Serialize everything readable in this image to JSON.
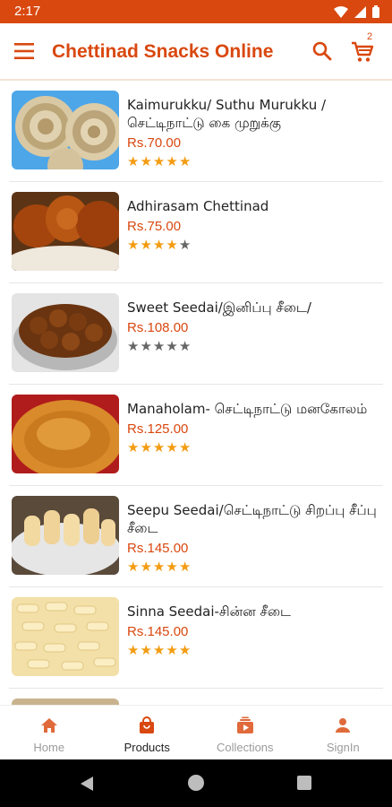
{
  "status": {
    "time": "2:17"
  },
  "appbar": {
    "title": "Chettinad Snacks Online",
    "cart_count": "2"
  },
  "products": [
    {
      "name": "Kaimurukku/ Suthu Murukku / செட்டிநாட்டு கை  முறுக்கு",
      "price": "Rs.70.00",
      "rating": 5,
      "image": "murukku-image"
    },
    {
      "name": "Adhirasam Chettinad",
      "price": "Rs.75.00",
      "rating": 4,
      "image": "adhirasam-image"
    },
    {
      "name": "Sweet Seedai/இனிப்பு சீடை/",
      "price": "Rs.108.00",
      "rating": 0,
      "image": "sweet-seedai-image"
    },
    {
      "name": "Manaholam- செட்டிநாட்டு மனகோலம்",
      "price": "Rs.125.00",
      "rating": 5,
      "image": "manaholam-image"
    },
    {
      "name": "Seepu Seedai/செட்டிநாட்டு சிறப்பு சீப்பு சீடை",
      "price": "Rs.145.00",
      "rating": 5,
      "image": "seepu-seedai-image"
    },
    {
      "name": "Sinna Seedai-சின்ன சீடை",
      "price": "Rs.145.00",
      "rating": 5,
      "image": "sinna-seedai-image"
    }
  ],
  "tabs": [
    {
      "label": "Home",
      "icon": "home-icon"
    },
    {
      "label": "Products",
      "icon": "bag-icon"
    },
    {
      "label": "Collections",
      "icon": "collections-icon"
    },
    {
      "label": "SignIn",
      "icon": "person-icon"
    }
  ],
  "colors": {
    "accent": "#d9480f",
    "star": "#f39c12",
    "star_empty": "#666666"
  }
}
